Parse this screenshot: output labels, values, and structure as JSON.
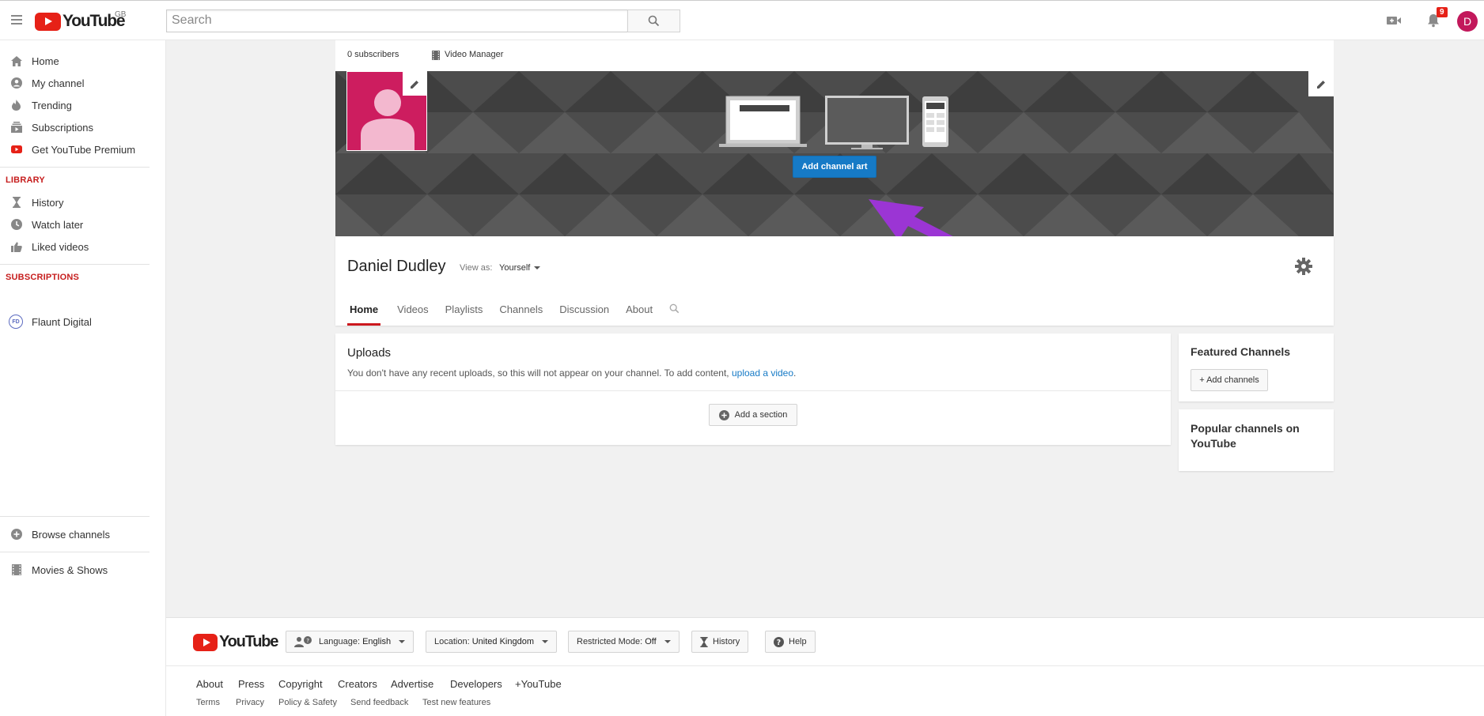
{
  "masthead": {
    "logo_text": "YouTube",
    "country": "GB",
    "search_placeholder": "Search",
    "notification_count": "9",
    "avatar_letter": "D"
  },
  "sidebar": {
    "main": [
      {
        "label": "Home",
        "icon": "home-icon"
      },
      {
        "label": "My channel",
        "icon": "account-icon"
      },
      {
        "label": "Trending",
        "icon": "flame-icon"
      },
      {
        "label": "Subscriptions",
        "icon": "subscriptions-icon"
      },
      {
        "label": "Get YouTube Premium",
        "icon": "youtube-red-icon"
      }
    ],
    "library_header": "LIBRARY",
    "library": [
      {
        "label": "History",
        "icon": "hourglass-icon"
      },
      {
        "label": "Watch later",
        "icon": "clock-icon"
      },
      {
        "label": "Liked videos",
        "icon": "thumbs-up-icon"
      }
    ],
    "subscriptions_header": "SUBSCRIPTIONS",
    "subscriptions": [
      {
        "label": "Flaunt Digital",
        "icon_text": "FD"
      }
    ],
    "browse_channels": "Browse channels",
    "movies_shows": "Movies & Shows"
  },
  "channel": {
    "subscribers": "0 subscribers",
    "video_manager": "Video Manager",
    "add_channel_art": "Add channel art",
    "name": "Daniel Dudley",
    "view_as_label": "View as:",
    "view_as_value": "Yourself",
    "tabs": [
      "Home",
      "Videos",
      "Playlists",
      "Channels",
      "Discussion",
      "About"
    ]
  },
  "uploads": {
    "title": "Uploads",
    "message": "You don't have any recent uploads, so this will not appear on your channel. To add content,",
    "link": "upload a video",
    "link_suffix": ".",
    "add_section": "Add a section"
  },
  "featured": {
    "title": "Featured Channels",
    "add_channels": "+ Add channels"
  },
  "popular": {
    "title": "Popular channels on YouTube"
  },
  "footer": {
    "logo_text": "YouTube",
    "language_label": "Language:",
    "language_value": "English",
    "location_label": "Location:",
    "location_value": "United Kingdom",
    "restricted_label": "Restricted Mode:",
    "restricted_value": "Off",
    "history": "History",
    "help": "Help",
    "links": [
      "About",
      "Press",
      "Copyright",
      "Creators",
      "Advertise",
      "Developers",
      "+YouTube"
    ],
    "sublinks": [
      "Terms",
      "Privacy",
      "Policy & Safety",
      "Send feedback",
      "Test new features"
    ]
  },
  "colors": {
    "youtube_red": "#e62117",
    "primary_blue": "#167ac6",
    "profile_pink": "#cd1d5f",
    "annotation_purple": "#9b35d4"
  }
}
